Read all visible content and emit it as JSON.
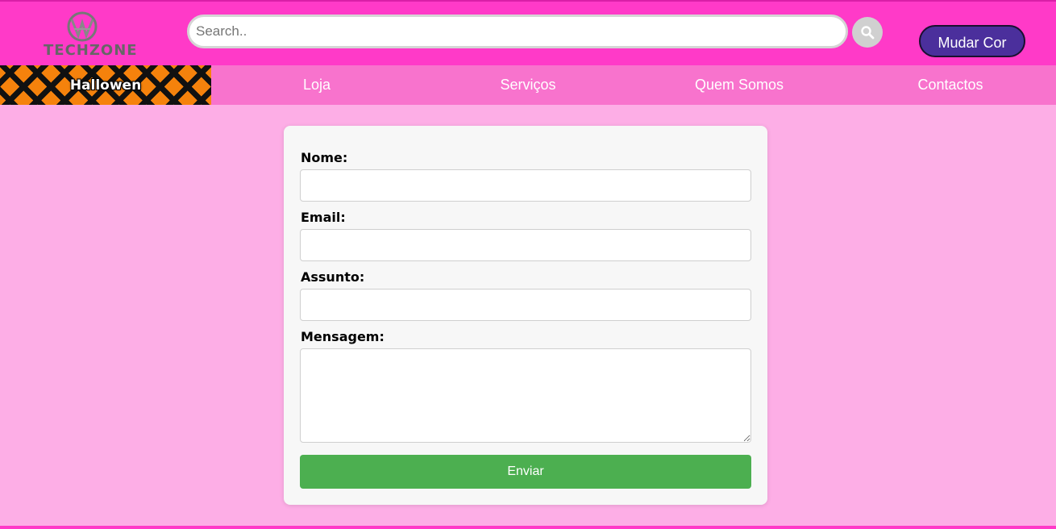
{
  "header": {
    "logo_text": "TECHZONE",
    "search_placeholder": "Search..",
    "search_value": "",
    "search_button_icon": "search-icon",
    "mudar_cor_label": "Mudar Cor",
    "colors": {
      "header_bg": "#ff3ac8",
      "button_bg": "#4b2f9c"
    }
  },
  "nav": {
    "items": [
      {
        "label": "Hallowen"
      },
      {
        "label": "Loja"
      },
      {
        "label": "Serviços"
      },
      {
        "label": "Quem Somos"
      },
      {
        "label": "Contactos"
      }
    ],
    "colors": {
      "nav_bg": "#f873cd",
      "halloween_accent": "#f5820c"
    }
  },
  "form": {
    "nome_label": "Nome:",
    "nome_value": "",
    "email_label": "Email:",
    "email_value": "",
    "assunto_label": "Assunto:",
    "assunto_value": "",
    "mensagem_label": "Mensagem:",
    "mensagem_value": "",
    "submit_label": "Enviar",
    "colors": {
      "submit_bg": "#4caf50",
      "page_bg": "#fdaee6"
    }
  }
}
